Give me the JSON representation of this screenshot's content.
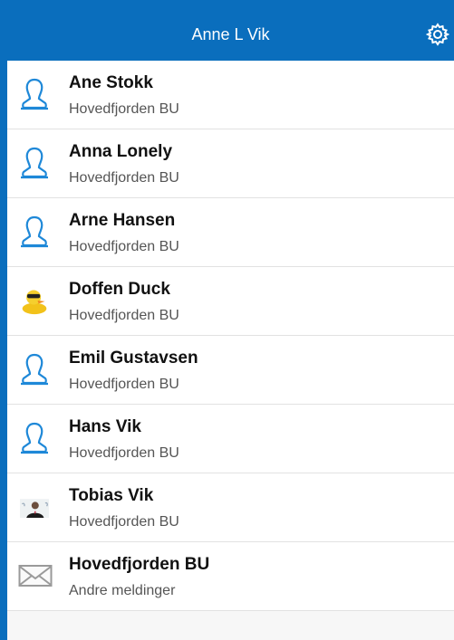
{
  "header": {
    "title": "Anne L Vik",
    "settings_icon": "gear-icon"
  },
  "contacts": [
    {
      "name": "Ane Stokk",
      "sub": "Hovedfjorden BU",
      "icon": "person-outline-icon"
    },
    {
      "name": "Anna Lonely",
      "sub": "Hovedfjorden BU",
      "icon": "person-outline-icon"
    },
    {
      "name": "Arne Hansen",
      "sub": "Hovedfjorden BU",
      "icon": "person-outline-icon"
    },
    {
      "name": "Doffen Duck",
      "sub": "Hovedfjorden BU",
      "icon": "duck-avatar-icon"
    },
    {
      "name": "Emil Gustavsen",
      "sub": "Hovedfjorden BU",
      "icon": "person-outline-icon"
    },
    {
      "name": "Hans Vik",
      "sub": "Hovedfjorden BU",
      "icon": "person-outline-icon"
    },
    {
      "name": "Tobias Vik",
      "sub": "Hovedfjorden BU",
      "icon": "photo-avatar-icon"
    },
    {
      "name": "Hovedfjorden BU",
      "sub": "Andre meldinger",
      "icon": "envelope-icon"
    }
  ],
  "colors": {
    "accent": "#0a6ebd",
    "icon_blue": "#1e88d8"
  }
}
